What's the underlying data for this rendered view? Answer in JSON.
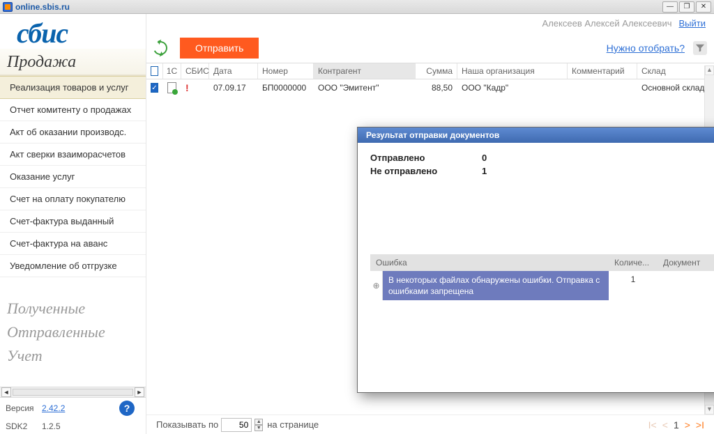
{
  "titlebar": {
    "title": "online.sbis.ru"
  },
  "header": {
    "username": "Алексеев Алексей Алексеевич",
    "logout": "Выйти"
  },
  "logo": "сбис",
  "section": "Продажа",
  "nav": [
    "Реализация товаров и услуг",
    "Отчет комитенту о продажах",
    "Акт об оказании производс.",
    "Акт сверки взаиморасчетов",
    "Оказание услуг",
    "Счет на оплату покупателю",
    "Счет-фактура выданный",
    "Счет-фактура на аванс",
    "Уведомление об отгрузке"
  ],
  "groups": [
    "Полученные",
    "Отправленные",
    "Учет"
  ],
  "version": {
    "label": "Версия",
    "value": "2.42.2"
  },
  "sdk": {
    "label": "SDK2",
    "value": "1.2.5"
  },
  "toolbar": {
    "send": "Отправить",
    "filter_link": "Нужно отобрать?"
  },
  "cols": {
    "ic": "1С",
    "sbis": "СБИС",
    "date": "Дата",
    "num": "Номер",
    "kagent": "Контрагент",
    "sum": "Сумма",
    "org": "Наша организация",
    "comment": "Комментарий",
    "sklad": "Склад"
  },
  "row": {
    "date": "07.09.17",
    "num": "БП0000000",
    "kagent": "ООО \"Эмитент\"",
    "sum": "88,50",
    "org": "ООО \"Кадр\"",
    "sklad": "Основной склад"
  },
  "dialog": {
    "title": "Результат отправки документов",
    "sent_label": "Отправлено",
    "sent_value": "0",
    "not_sent_label": "Не отправлено",
    "not_sent_value": "1",
    "cols": {
      "err": "Ошибка",
      "cnt": "Количе...",
      "doc": "Документ"
    },
    "row": {
      "msg": "В некоторых файлах обнаружены ошибки. Отправка с ошибками запрещена",
      "cnt": "1",
      "doc": ""
    }
  },
  "footer": {
    "show_by": "Показывать по",
    "per_page": "50",
    "on_page": "на странице",
    "page": "1"
  }
}
